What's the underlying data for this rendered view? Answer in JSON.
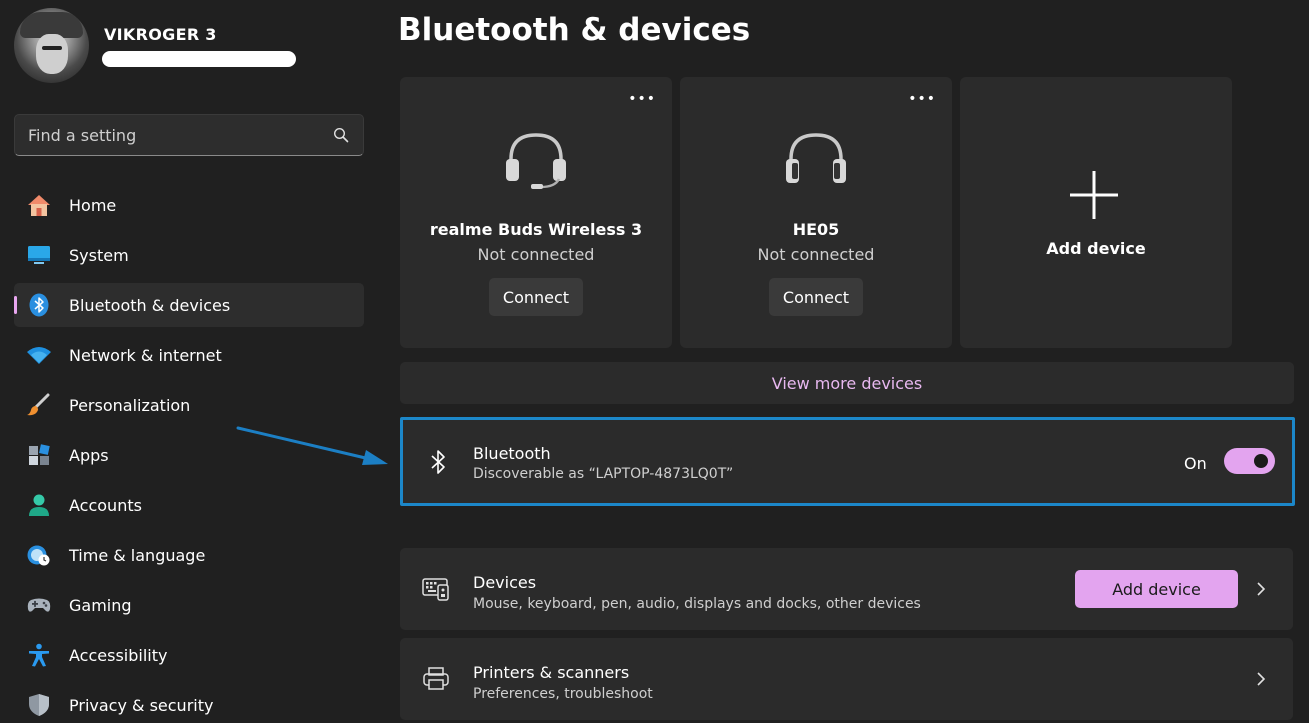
{
  "profile": {
    "name": "VIKROGER 3"
  },
  "search": {
    "placeholder": "Find a setting"
  },
  "nav": {
    "items": [
      {
        "label": "Home",
        "icon": "home-icon"
      },
      {
        "label": "System",
        "icon": "system-icon"
      },
      {
        "label": "Bluetooth & devices",
        "icon": "bluetooth-icon",
        "active": true
      },
      {
        "label": "Network & internet",
        "icon": "wifi-icon"
      },
      {
        "label": "Personalization",
        "icon": "brush-icon"
      },
      {
        "label": "Apps",
        "icon": "apps-icon"
      },
      {
        "label": "Accounts",
        "icon": "accounts-icon"
      },
      {
        "label": "Time & language",
        "icon": "time-language-icon"
      },
      {
        "label": "Gaming",
        "icon": "gamepad-icon"
      },
      {
        "label": "Accessibility",
        "icon": "accessibility-icon"
      },
      {
        "label": "Privacy & security",
        "icon": "shield-icon"
      }
    ]
  },
  "page": {
    "title": "Bluetooth & devices"
  },
  "devices": [
    {
      "name": "realme Buds Wireless 3",
      "status": "Not connected",
      "action": "Connect",
      "icon": "headset-icon"
    },
    {
      "name": "HE05",
      "status": "Not connected",
      "action": "Connect",
      "icon": "headphones-icon"
    }
  ],
  "add_card": {
    "label": "Add device"
  },
  "view_more": {
    "label": "View more devices"
  },
  "bluetooth": {
    "title": "Bluetooth",
    "subtitle": "Discoverable as “LAPTOP-4873LQ0T”",
    "state": "On",
    "enabled": true
  },
  "rows": {
    "devices": {
      "title": "Devices",
      "subtitle": "Mouse, keyboard, pen, audio, displays and docks, other devices",
      "button": "Add device"
    },
    "printers": {
      "title": "Printers & scanners",
      "subtitle": "Preferences, troubleshoot"
    }
  },
  "colors": {
    "background": "#202020",
    "card": "#2b2b2b",
    "accent": "#e3a4ef",
    "highlight_border": "#1c87c9"
  }
}
